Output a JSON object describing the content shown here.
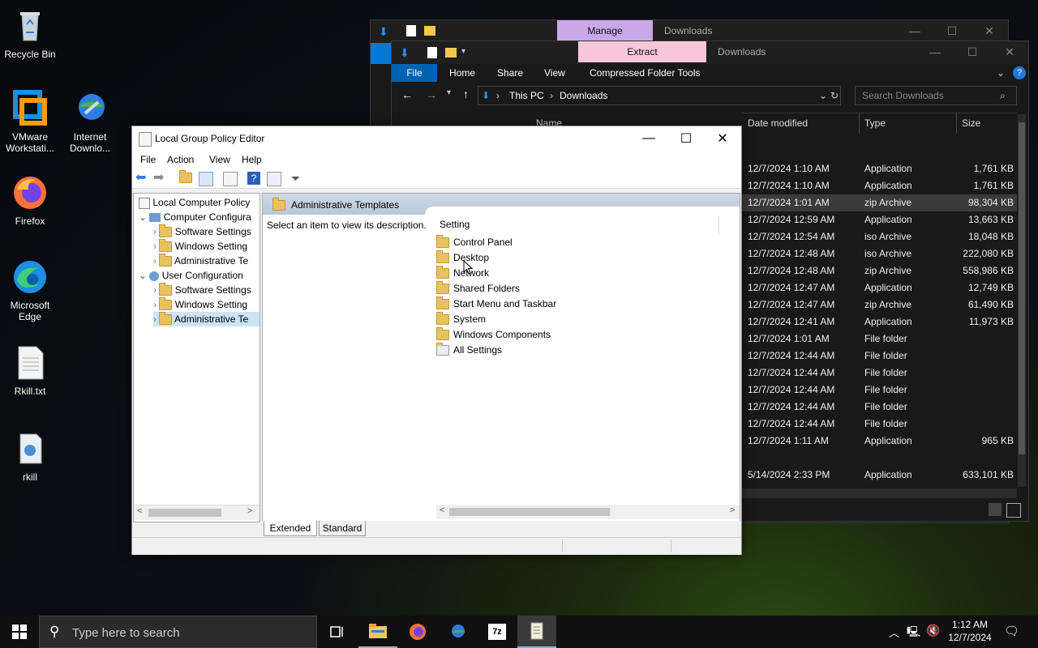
{
  "desktop": {
    "icons": [
      {
        "label": "Recycle Bin"
      },
      {
        "label": "VMware Workstati..."
      },
      {
        "label": "Internet Downlo..."
      },
      {
        "label": "Firefox"
      },
      {
        "label": "Microsoft Edge"
      },
      {
        "label": "Rkill.txt"
      },
      {
        "label": "rkill"
      }
    ]
  },
  "explorer_back": {
    "context_tab": "Manage",
    "title": "Downloads"
  },
  "explorer_front": {
    "context_tab": "Extract",
    "title": "Downloads",
    "ribbon_tabs": [
      "File",
      "Home",
      "Share",
      "View",
      "Compressed Folder Tools"
    ],
    "breadcrumb": [
      "This PC",
      "Downloads"
    ],
    "search_placeholder": "Search Downloads",
    "columns": {
      "name": "Name",
      "date": "Date modified",
      "type": "Type",
      "size": "Size"
    },
    "rows": [
      {
        "date": "12/7/2024 1:10 AM",
        "type": "Application",
        "size": "1,761 KB"
      },
      {
        "date": "12/7/2024 1:10 AM",
        "type": "Application",
        "size": "1,761 KB"
      },
      {
        "date": "12/7/2024 1:01 AM",
        "type": "zip Archive",
        "size": "98,304 KB"
      },
      {
        "date": "12/7/2024 12:59 AM",
        "type": "Application",
        "size": "13,663 KB"
      },
      {
        "date": "12/7/2024 12:54 AM",
        "type": "iso Archive",
        "size": "18,048 KB"
      },
      {
        "date": "12/7/2024 12:48 AM",
        "type": "iso Archive",
        "size": "222,080 KB"
      },
      {
        "date": "12/7/2024 12:48 AM",
        "type": "zip Archive",
        "size": "558,986 KB"
      },
      {
        "date": "12/7/2024 12:47 AM",
        "type": "Application",
        "size": "12,749 KB"
      },
      {
        "date": "12/7/2024 12:47 AM",
        "type": "zip Archive",
        "size": "61,490 KB"
      },
      {
        "date": "12/7/2024 12:41 AM",
        "type": "Application",
        "size": "11,973 KB"
      },
      {
        "date": "12/7/2024 1:01 AM",
        "type": "File folder",
        "size": ""
      },
      {
        "date": "12/7/2024 12:44 AM",
        "type": "File folder",
        "size": ""
      },
      {
        "date": "12/7/2024 12:44 AM",
        "type": "File folder",
        "size": ""
      },
      {
        "date": "12/7/2024 12:44 AM",
        "type": "File folder",
        "size": ""
      },
      {
        "date": "12/7/2024 12:44 AM",
        "type": "File folder",
        "size": ""
      },
      {
        "date": "12/7/2024 12:44 AM",
        "type": "File folder",
        "size": ""
      },
      {
        "date": "12/7/2024 1:11 AM",
        "type": "Application",
        "size": "965 KB"
      },
      {
        "date": "5/14/2024 2:33 PM",
        "type": "Application",
        "size": "633,101 KB"
      }
    ]
  },
  "gpe": {
    "title": "Local Group Policy Editor",
    "menu": [
      "File",
      "Action",
      "View",
      "Help"
    ],
    "tree": [
      {
        "label": "Local Computer Policy"
      },
      {
        "label": "Computer Configura"
      },
      {
        "label": "Software Settings"
      },
      {
        "label": "Windows Setting"
      },
      {
        "label": "Administrative Te"
      },
      {
        "label": "User Configuration"
      },
      {
        "label": "Software Settings"
      },
      {
        "label": "Windows Setting"
      },
      {
        "label": "Administrative Te"
      }
    ],
    "header": "Administrative Templates",
    "description": "Select an item to view its description.",
    "setting_col": "Setting",
    "settings": [
      "Control Panel",
      "Desktop",
      "Network",
      "Shared Folders",
      "Start Menu and Taskbar",
      "System",
      "Windows Components",
      "All Settings"
    ],
    "tabs": [
      "Extended",
      "Standard"
    ]
  },
  "taskbar": {
    "search_placeholder": "Type here to search",
    "time": "1:12 AM",
    "date": "12/7/2024"
  }
}
